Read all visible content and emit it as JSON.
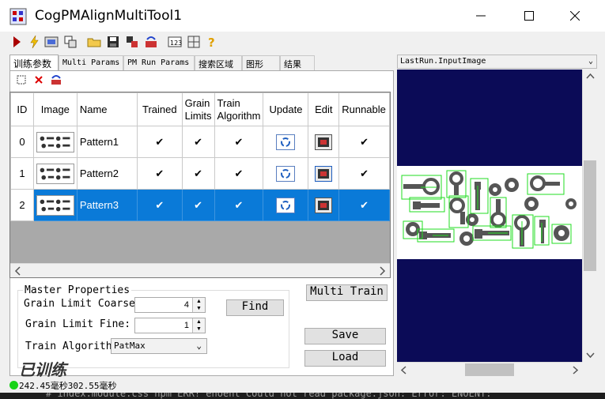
{
  "window": {
    "title": "CogPMAlignMultiTool1"
  },
  "tabs": [
    {
      "label": "训练参数",
      "active": true
    },
    {
      "label": "Multi Params",
      "active": false
    },
    {
      "label": "PM Run Params",
      "active": false
    },
    {
      "label": "搜索区域",
      "active": false
    },
    {
      "label": "图形",
      "active": false
    },
    {
      "label": "结果",
      "active": false
    }
  ],
  "grid": {
    "columns": [
      "ID",
      "Image",
      "Name",
      "Trained",
      "Grain Limits",
      "Train Algorithm",
      "Update",
      "Edit",
      "Runnable"
    ],
    "rows": [
      {
        "id": "0",
        "name": "Pattern1",
        "trained": "✔",
        "grain": "✔",
        "algo": "✔",
        "runnable": "✔",
        "selected": false
      },
      {
        "id": "1",
        "name": "Pattern2",
        "trained": "✔",
        "grain": "✔",
        "algo": "✔",
        "runnable": "✔",
        "selected": false
      },
      {
        "id": "2",
        "name": "Pattern3",
        "trained": "✔",
        "grain": "✔",
        "algo": "✔",
        "runnable": "✔",
        "selected": true
      }
    ]
  },
  "master": {
    "legend": "Master Properties",
    "coarse_label": "Grain Limit Coarse:",
    "coarse_value": "4",
    "fine_label": "Grain Limit Fine:",
    "fine_value": "1",
    "algo_label": "Train Algorith",
    "algo_value": "PatMax"
  },
  "buttons": {
    "multi_train": "Multi Train",
    "find": "Find",
    "save": "Save",
    "load": "Load"
  },
  "status_label": "已训练",
  "image_panel": {
    "selector": "LastRun.InputImage"
  },
  "statusbar": {
    "text": "242.45毫秒302.55毫秒"
  },
  "background_text": "#  index.module.css      npm ERR! enoent Could not read package.json: Error: ENOENT:",
  "colors": {
    "selection": "#0a7ad8",
    "viewer_bg": "#0b0b57",
    "graphic_green": "#22dd22",
    "status_ok": "#17d317"
  }
}
